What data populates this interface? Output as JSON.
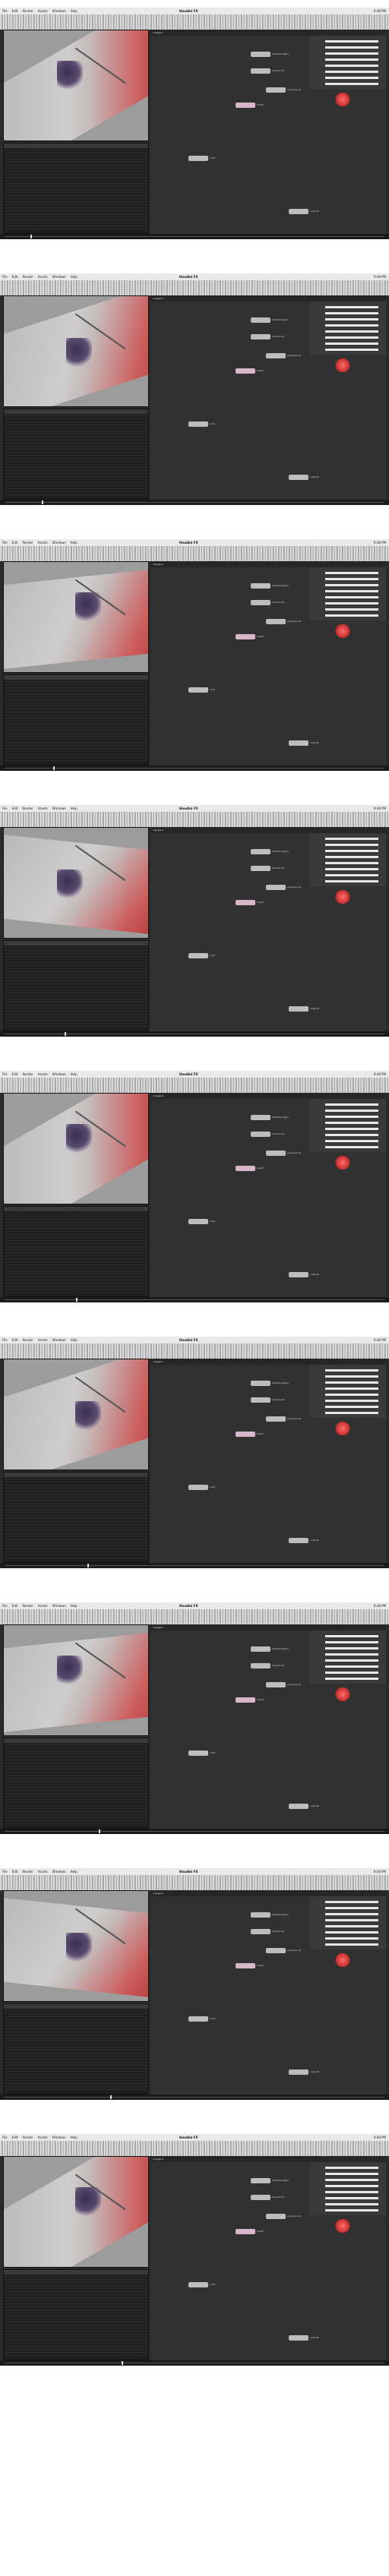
{
  "frames": [
    {
      "title": "Houdini FX",
      "clock": "9:48 PM",
      "path": "/obj/geo1"
    },
    {
      "title": "Houdini FX",
      "clock": "9:48 PM",
      "path": "/obj/geo1"
    },
    {
      "title": "Houdini FX",
      "clock": "9:48 PM",
      "path": "/obj/geo1"
    },
    {
      "title": "Houdini FX",
      "clock": "9:48 PM",
      "path": "/obj/geo1"
    },
    {
      "title": "Houdini FX",
      "clock": "9:48 PM",
      "path": "/obj/geo1"
    },
    {
      "title": "Houdini FX",
      "clock": "9:48 PM",
      "path": "/obj/geo1"
    },
    {
      "title": "Houdini FX",
      "clock": "9:48 PM",
      "path": "/obj/geo1"
    },
    {
      "title": "Houdini FX",
      "clock": "9:48 PM",
      "path": "/obj/geo1"
    },
    {
      "title": "Houdini FX",
      "clock": "9:48 PM",
      "path": "/obj/geo1"
    }
  ],
  "menu": [
    "File",
    "Edit",
    "Render",
    "Assets",
    "Windows",
    "Help"
  ],
  "nodes": [
    {
      "label": "attribwrangle1"
    },
    {
      "label": "transform1"
    },
    {
      "label": "polyreduce1"
    },
    {
      "label": "blast1"
    },
    {
      "label": "null1"
    },
    {
      "label": "output0"
    }
  ],
  "colors": {
    "frame_bg": "#2b2b2b",
    "accent": "#c8302e"
  }
}
